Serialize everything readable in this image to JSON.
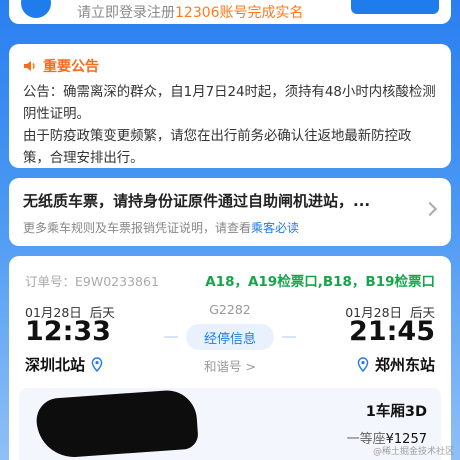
{
  "login_banner": {
    "text_prefix": "请立即登录注册",
    "text_highlight": "12306账号完成实名"
  },
  "notice": {
    "title": "重要公告",
    "body": "公告：确需离深的群众，自1月7日24时起，须持有48小时内核酸检测阴性证明。\n由于防疫政策变更频繁，请您在出行前务必确认往返地最新防控政策，合理安排出行。"
  },
  "paperless": {
    "title": "无纸质车票，请持身份证原件通过自助闸机进站，...",
    "sub_prefix": "更多乘车规则及车票报销凭证说明，请查看",
    "sub_link": "乘客必读"
  },
  "order": {
    "order_no_label": "订单号：",
    "order_no": "E9W0233861",
    "gates": "A18，A19检票口,B18，B19检票口",
    "depart": {
      "date": "01月28日",
      "day": "后天",
      "time": "12:33",
      "station": "深圳北站"
    },
    "arrive": {
      "date": "01月28日",
      "day": "后天",
      "time": "21:45",
      "station": "郑州东站"
    },
    "train_no": "G2282",
    "via_label": "经停信息",
    "train_name": "和谐号 >",
    "car": "1车厢3D",
    "seat_class": "一等座",
    "price": "¥1257"
  },
  "watermark": "@稀土掘金技术社区",
  "colors": {
    "accent": "#1f7cec",
    "notice": "#ff6a1a",
    "gates": "#17a54b"
  }
}
